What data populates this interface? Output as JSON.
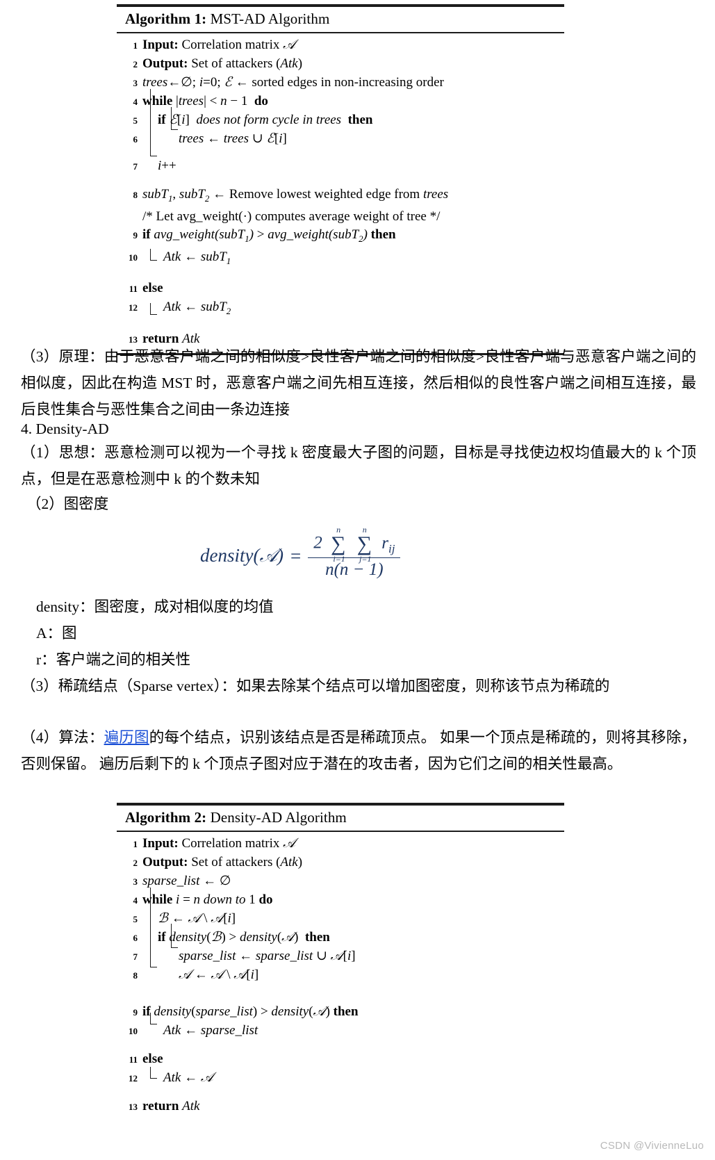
{
  "algorithm1": {
    "title_label": "Algorithm 1:",
    "title_name": "MST-AD Algorithm",
    "lines": [
      {
        "n": "1",
        "text": "Input: Correlation matrix ᴀ"
      },
      {
        "n": "2",
        "text": "Output: Set of attackers (Atk)"
      },
      {
        "n": "3",
        "text": "trees ← ∅; i ← 0; ℰ ← sorted edges in non-increasing order"
      },
      {
        "n": "4",
        "text": "while |trees| < n − 1  do"
      },
      {
        "n": "5",
        "text": "if ℰ[i]  does not form cycle in trees  then"
      },
      {
        "n": "6",
        "text": "trees ← trees ∪ ℰ[i]"
      },
      {
        "n": "7",
        "text": "i++"
      },
      {
        "n": "8",
        "text": "subT₁, subT₂ ← Remove lowest weighted edge from trees"
      },
      {
        "n": "",
        "text": "/* Let avg_weight(·) computes average weight of tree */"
      },
      {
        "n": "9",
        "text": "if avg_weight(subT₁) > avg_weight(subT₂) then"
      },
      {
        "n": "10",
        "text": "Atk ← subT₁"
      },
      {
        "n": "11",
        "text": "else"
      },
      {
        "n": "12",
        "text": "Atk ← subT₂"
      },
      {
        "n": "13",
        "text": "return Atk"
      }
    ]
  },
  "paragraphs": {
    "p_principle": "（3）原理：由于恶意客户端之间的相似度>良性客户端之间的相似度>良性客户端与恶意客户端之间的相似度，因此在构造 MST 时，恶意客户端之间先相互连接，然后相似的良性客户端之间相互连接，最后良性集合与恶性集合之间由一条边连接",
    "heading_density_ad": "4. Density-AD",
    "p_idea": "（1）思想：恶意检测可以视为一个寻找 k 密度最大子图的问题，目标是寻找使边权均值最大的 k 个顶点，但是在恶意检测中 k 的个数未知",
    "p_graph_density": "（2）图密度",
    "def_density": "density：图密度，成对相似度的均值",
    "def_A": "A：图",
    "def_r": "r：客户端之间的相关性",
    "p_sparse_vertex": "（3）稀疏结点（Sparse vertex）：如果去除某个结点可以增加图密度，则称该节点为稀疏的",
    "p_algorithm_prefix": "（4）算法：",
    "p_algorithm_link": "遍历图",
    "p_algorithm_rest": "的每个结点，识别该结点是否是稀疏顶点。 如果一个顶点是稀疏的，则将其移除，否则保留。 遍历后剩下的 k 个顶点子图对应于潜在的攻击者，因为它们之间的相关性最高。"
  },
  "formula": {
    "lhs": "density(𝒜)",
    "eq": "=",
    "numerator_coeff": "2",
    "sum1_top": "n",
    "sum1_bottom": "i=1",
    "sum2_top": "n",
    "sum2_bottom": "j=1",
    "numerator_term": "r",
    "numerator_term_sub": "ij",
    "denominator": "n(n − 1)",
    "color": "#1f3864"
  },
  "algorithm2": {
    "title_label": "Algorithm 2:",
    "title_name": "Density-AD Algorithm",
    "lines": [
      {
        "n": "1",
        "text": "Input: Correlation matrix ᴀ"
      },
      {
        "n": "2",
        "text": "Output: Set of attackers (Atk)"
      },
      {
        "n": "3",
        "text": "sparse_list ← ∅"
      },
      {
        "n": "4",
        "text": "while i = n down to 1 do"
      },
      {
        "n": "5",
        "text": "ℬ ← 𝒜 \\ 𝒜[i]"
      },
      {
        "n": "6",
        "text": "if density(ℬ) > density(𝒜)  then"
      },
      {
        "n": "7",
        "text": "sparse_list ← sparse_list ∪ 𝒜[i]"
      },
      {
        "n": "8",
        "text": "𝒜 ← 𝒜 \\ 𝒜[i]"
      },
      {
        "n": "9",
        "text": "if density(sparse_list) > density(𝒜) then"
      },
      {
        "n": "10",
        "text": "Atk ← sparse_list"
      },
      {
        "n": "11",
        "text": "else"
      },
      {
        "n": "12",
        "text": "Atk ← 𝒜"
      },
      {
        "n": "13",
        "text": "return Atk"
      }
    ]
  },
  "watermark": "CSDN @VivienneLuo"
}
